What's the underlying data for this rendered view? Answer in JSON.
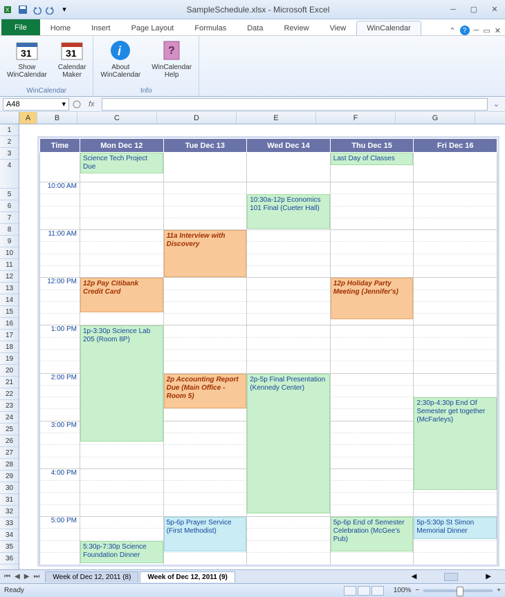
{
  "title": "SampleSchedule.xlsx - Microsoft Excel",
  "tabs": {
    "file": "File",
    "home": "Home",
    "insert": "Insert",
    "page": "Page Layout",
    "formulas": "Formulas",
    "data": "Data",
    "review": "Review",
    "view": "View",
    "wincal": "WinCalendar"
  },
  "ribbon": {
    "group1": {
      "label": "WinCalendar",
      "show": "Show\nWinCalendar",
      "maker": "Calendar\nMaker"
    },
    "group2": {
      "label": "Info",
      "about": "About\nWinCalendar",
      "help": "WinCalendar\nHelp"
    }
  },
  "namebox": "A48",
  "fx": "fx",
  "columns": [
    "A",
    "B",
    "C",
    "D",
    "E",
    "F",
    "G"
  ],
  "rows": [
    "1",
    "2",
    "3",
    "4",
    "5",
    "6",
    "7",
    "8",
    "9",
    "10",
    "11",
    "12",
    "13",
    "14",
    "15",
    "16",
    "17",
    "18",
    "19",
    "20",
    "21",
    "22",
    "23",
    "24",
    "25",
    "26",
    "27",
    "28",
    "29",
    "30",
    "31",
    "32",
    "33",
    "34",
    "35",
    "36"
  ],
  "cal_headers": [
    "Time",
    "Mon Dec 12",
    "Tue Dec 13",
    "Wed Dec 14",
    "Thu Dec 15",
    "Fri Dec 16"
  ],
  "times": {
    "t10": "10:00 AM",
    "t11": "11:00 AM",
    "t12": "12:00 PM",
    "t13": "1:00 PM",
    "t14": "2:00 PM",
    "t15": "3:00 PM",
    "t16": "4:00 PM",
    "t17": "5:00 PM"
  },
  "events": {
    "sci_proj": "Science Tech Project Due",
    "last_day": "Last Day of Classes",
    "econ": "10:30a-12p Economics 101 Final (Cueter Hall)",
    "interview": "11a Interview with Discovery",
    "citibank": "12p Pay Citibank Credit Card",
    "holiday": "12p Holiday Party Meeting (Jennifer's)",
    "scilab": "1p-3:30p Science Lab 205 (Room 8P)",
    "accounting": "2p Accounting Report Due (Main Office - Room 5)",
    "finalpres": "2p-5p Final Presentation (Kennedy Center)",
    "endsem": "2:30p-4:30p End Of Semester get together (McFarleys)",
    "prayer": "5p-6p Prayer Service (First Methodist)",
    "celebration": "5p-6p End of Semester Celebration (McGee's Pub)",
    "stsimon": "5p-5:30p St Simon Memorial Dinner",
    "foundation": "5:30p-7:30p Science Foundation Dinner"
  },
  "sheet_tabs": {
    "prev": "Week of Dec 12, 2011 (8)",
    "active": "Week of Dec 12, 2011 (9)"
  },
  "statusbar": {
    "ready": "Ready",
    "zoom": "100%"
  }
}
